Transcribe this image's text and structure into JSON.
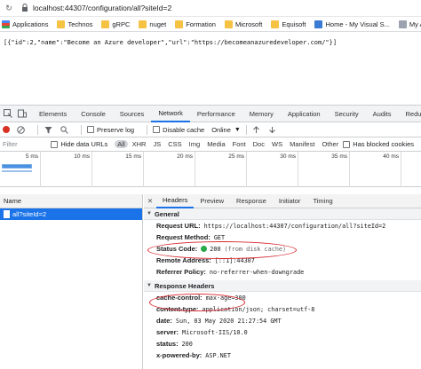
{
  "browser": {
    "url": "localhost:44307/configuration/all?siteId=2",
    "bookmarks": [
      {
        "label": "Applications",
        "icon": "apps-grid-icon",
        "kind": "apps"
      },
      {
        "label": "Technos",
        "icon": "folder-icon",
        "kind": "folder"
      },
      {
        "label": "gRPC",
        "icon": "folder-icon",
        "kind": "folder"
      },
      {
        "label": "nuget",
        "icon": "folder-icon",
        "kind": "folder"
      },
      {
        "label": "Formation",
        "icon": "folder-icon",
        "kind": "folder"
      },
      {
        "label": "Microsoft",
        "icon": "folder-icon",
        "kind": "folder"
      },
      {
        "label": "Equisoft",
        "icon": "folder-icon",
        "kind": "folder"
      },
      {
        "label": "Home - My Visual S...",
        "icon": "visual-studio-icon",
        "kind": "vs"
      },
      {
        "label": "My Account Infi",
        "icon": "account-icon",
        "kind": "acct"
      }
    ]
  },
  "page": {
    "json_text": "[{\"id\":2,\"name\":\"Become an Azure developer\",\"url\":\"https://becomeanazuredeveloper.com/\"}]"
  },
  "devtools": {
    "tabs": [
      "Elements",
      "Console",
      "Sources",
      "Network",
      "Performance",
      "Memory",
      "Application",
      "Security",
      "Audits",
      "Redux"
    ],
    "active_tab": "Network",
    "toolbar": {
      "preserve_log": "Preserve log",
      "disable_cache": "Disable cache",
      "throttle": "Online"
    },
    "filter": {
      "placeholder": "Filter",
      "hide_data_urls": "Hide data URLs",
      "types": [
        "All",
        "XHR",
        "JS",
        "CSS",
        "Img",
        "Media",
        "Font",
        "Doc",
        "WS",
        "Manifest",
        "Other"
      ],
      "blocked_cookies": "Has blocked cookies"
    },
    "overview_ticks": [
      "5 ms",
      "10 ms",
      "15 ms",
      "20 ms",
      "25 ms",
      "30 ms",
      "35 ms",
      "40 ms"
    ],
    "requests": {
      "name_header": "Name",
      "items": [
        "all?siteId=2"
      ]
    },
    "details": {
      "tabs": [
        "Headers",
        "Preview",
        "Response",
        "Initiator",
        "Timing"
      ],
      "active_tab": "Headers",
      "close": "✕",
      "general": {
        "title": "General",
        "rows": [
          {
            "key": "Request URL:",
            "value": "https://localhost:44307/configuration/all?siteId=2"
          },
          {
            "key": "Request Method:",
            "value": "GET"
          },
          {
            "key": "Status Code:",
            "value": "200",
            "note": "(from disk cache)"
          },
          {
            "key": "Remote Address:",
            "value": "[::1]:44307"
          },
          {
            "key": "Referrer Policy:",
            "value": "no-referrer-when-downgrade"
          }
        ]
      },
      "response_headers": {
        "title": "Response Headers",
        "rows": [
          {
            "key": "cache-control:",
            "value": "max-age=300"
          },
          {
            "key": "content-type:",
            "value": "application/json; charset=utf-8"
          },
          {
            "key": "date:",
            "value": "Sun, 03 May 2020 21:27:54 GMT"
          },
          {
            "key": "server:",
            "value": "Microsoft-IIS/10.0"
          },
          {
            "key": "status:",
            "value": "200"
          },
          {
            "key": "x-powered-by:",
            "value": "ASP.NET"
          }
        ]
      }
    }
  },
  "colors": {
    "accent": "#1a73e8",
    "status_ok": "#2aa84a",
    "annotation": "#d6272f",
    "record": "#d93025"
  }
}
